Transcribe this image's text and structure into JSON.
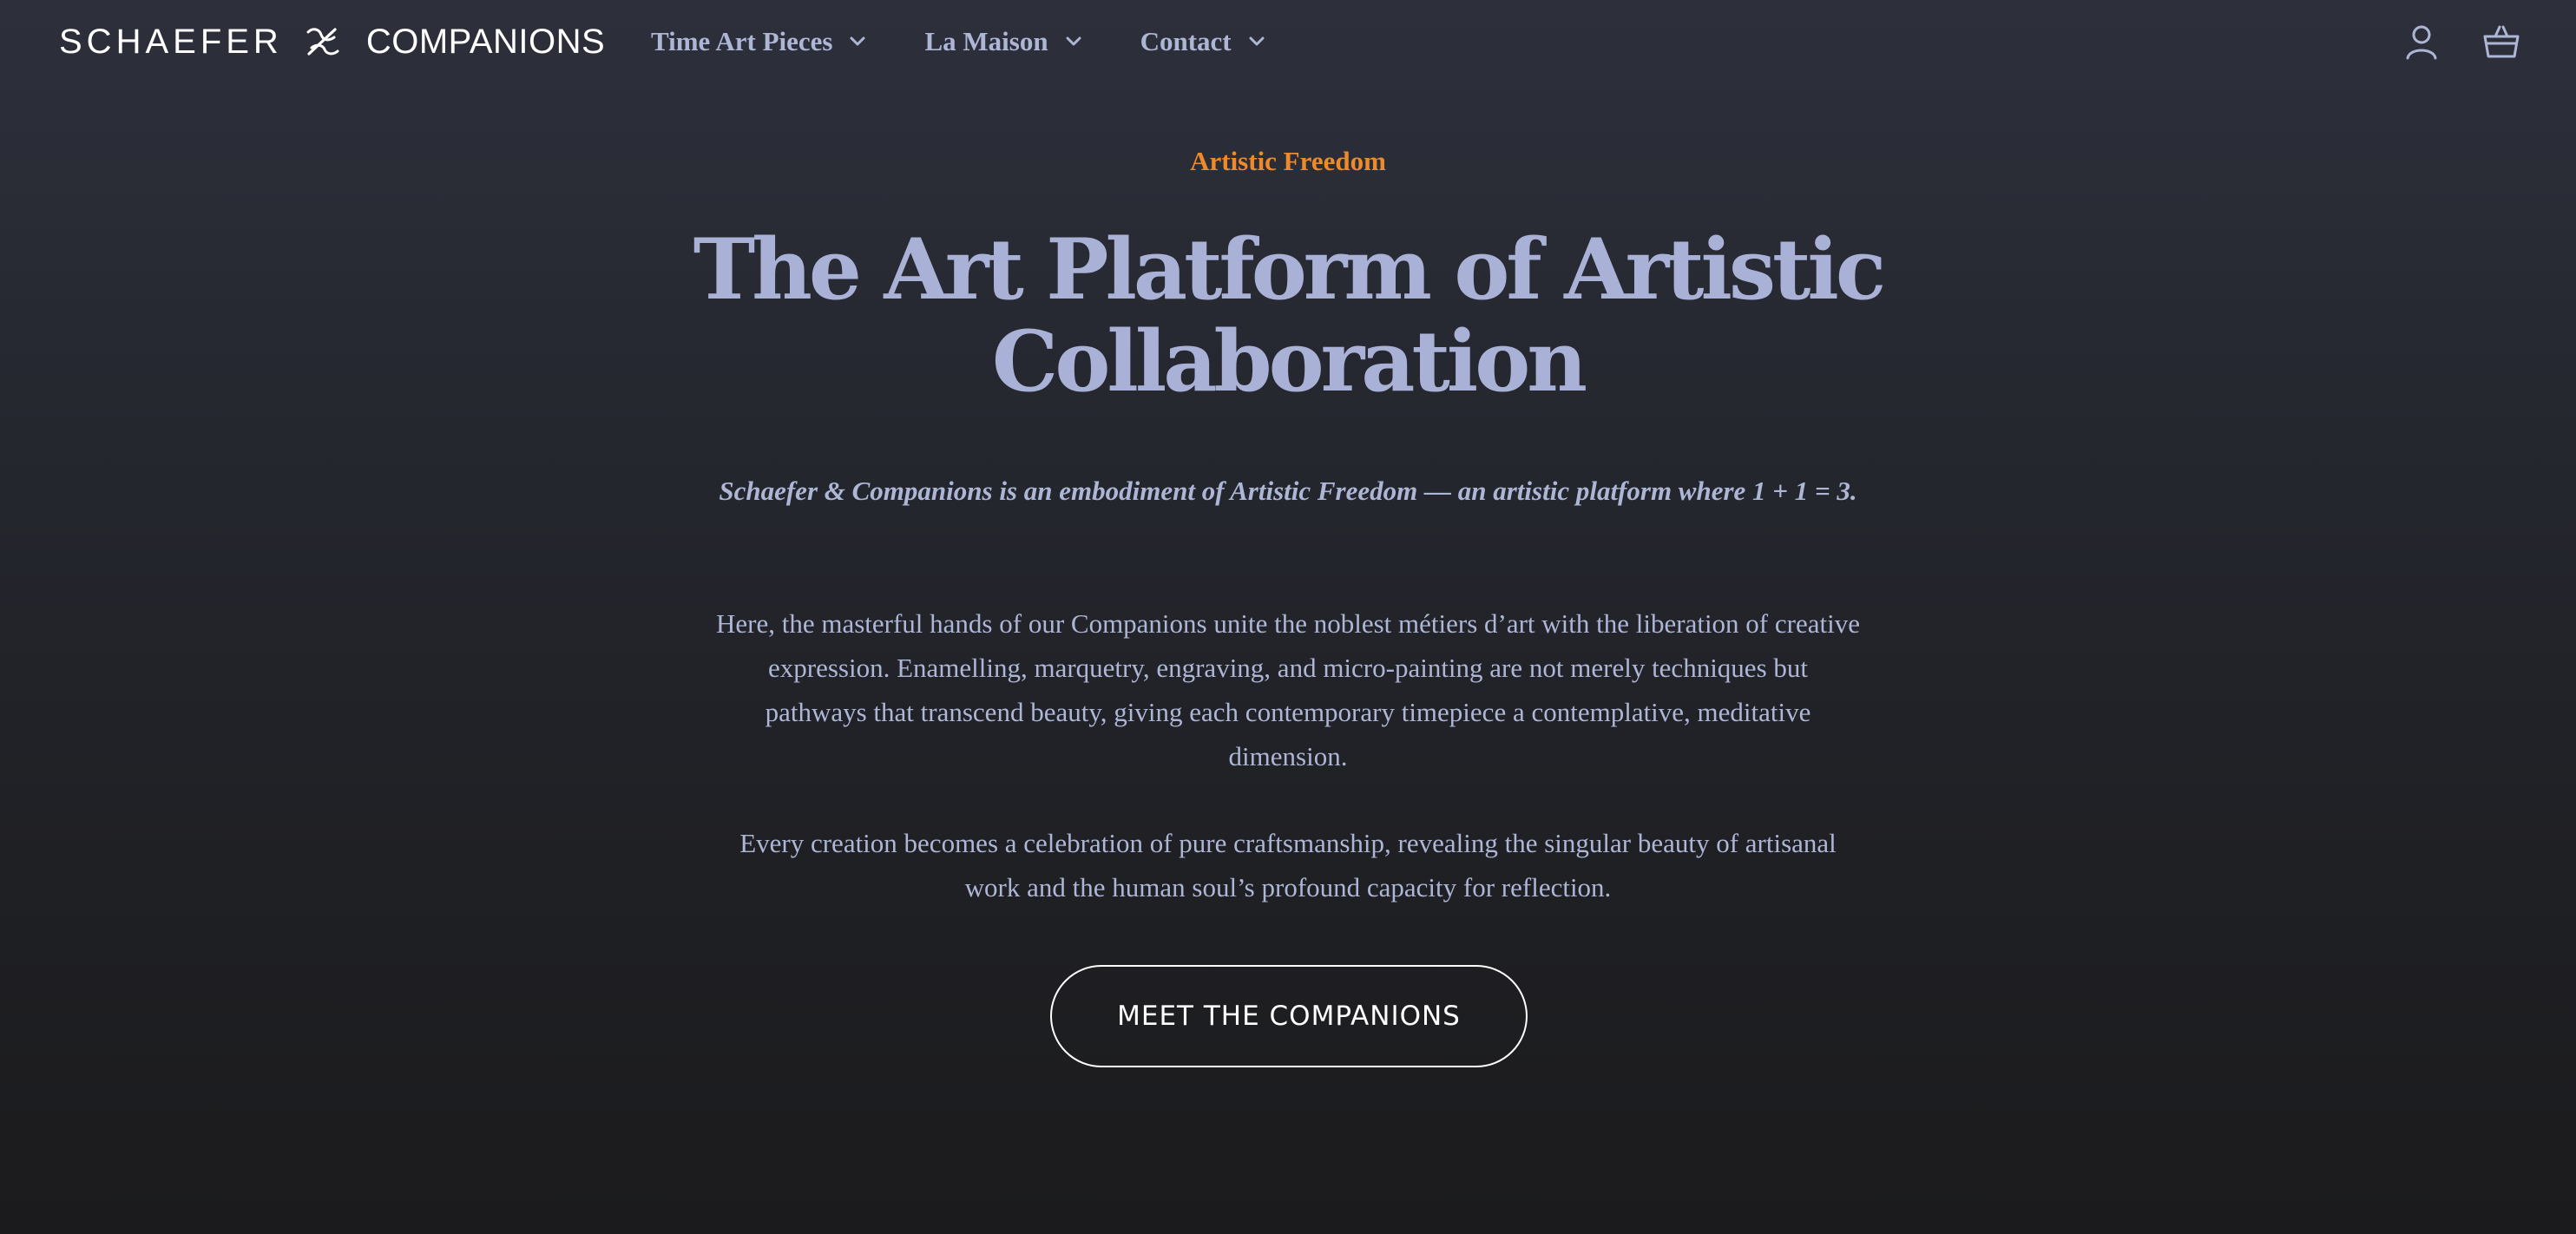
{
  "brand": {
    "logo_left": "SCHAEFER",
    "logo_right": "COMPANIONS",
    "logo_mark_icon": "ampersand-x-mark-icon"
  },
  "nav": {
    "items": [
      {
        "label": "Time Art Pieces",
        "icon": "chevron-down-icon"
      },
      {
        "label": "La Maison",
        "icon": "chevron-down-icon"
      },
      {
        "label": "Contact",
        "icon": "chevron-down-icon"
      }
    ]
  },
  "header_icons": {
    "account": "user-icon",
    "cart": "basket-icon"
  },
  "hero": {
    "eyebrow": "Artistic Freedom",
    "headline": "The Art Platform of Artistic Collaboration",
    "lead": "Schaefer & Companions is an embodiment of Artistic Freedom — an artistic platform where 1 + 1 = 3.",
    "paragraph_1": "Here, the masterful hands of our Companions unite the noblest métiers d’art with the liberation of creative expression. Enamelling, marquetry, engraving, and micro-painting are not merely techniques but pathways that transcend beauty, giving each contemporary timepiece a contemplative, meditative dimension.",
    "paragraph_2": "Every creation becomes a celebration of pure craftsmanship, revealing the singular beauty of artisanal work and the human soul’s profound capacity for reflection.",
    "cta_label": "MEET THE COMPANIONS"
  },
  "colors": {
    "accent": "#ed8a2a",
    "text": "#aeb6d6",
    "headline": "#a9b1d6",
    "white": "#ffffff",
    "background_top": "#2d2f3b",
    "background_bottom": "#1b1b1d"
  }
}
